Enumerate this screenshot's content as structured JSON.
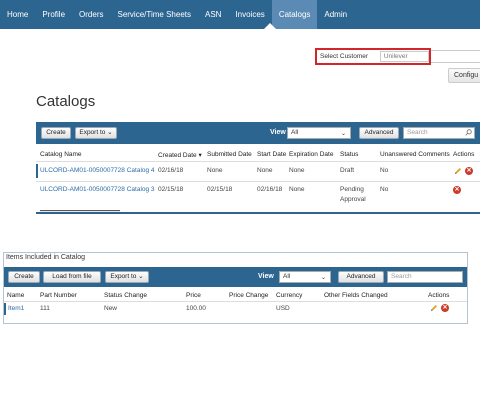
{
  "nav": {
    "items": [
      "Home",
      "Profile",
      "Orders",
      "Service/Time Sheets",
      "ASN",
      "Invoices",
      "Catalogs",
      "Admin"
    ],
    "active": "Catalogs"
  },
  "customer": {
    "label": "Select Customer",
    "value": "Unilever"
  },
  "configure_label": "Configu",
  "page_title": "Catalogs",
  "catalogs_toolbar": {
    "create": "Create",
    "export": "Export to ⌄",
    "view_label": "View",
    "view_value": "All",
    "advanced": "Advanced",
    "search_placeholder": "Search"
  },
  "catalogs_table": {
    "headers": [
      "Catalog Name",
      "Created Date ▾",
      "Submitted Date",
      "Start Date",
      "Expiration Date",
      "Status",
      "Unanswered Comments",
      "Actions"
    ],
    "rows": [
      {
        "name": "ULCORD-AM01-0050007728 Catalog 4",
        "created": "02/16/18",
        "submitted": "None",
        "start": "None",
        "expiration": "None",
        "status": "Draft",
        "status2": "",
        "comments": "No"
      },
      {
        "name": "ULCORD-AM01-0050007728 Catalog 3",
        "created": "02/15/18",
        "submitted": "02/15/18",
        "start": "02/16/18",
        "expiration": "None",
        "status": "Pending",
        "status2": "Approval",
        "comments": "No"
      }
    ]
  },
  "items_panel": {
    "title": "Items Included in Catalog",
    "toolbar": {
      "create": "Create",
      "load": "Load from file",
      "export": "Export to ⌄",
      "view_label": "View",
      "view_value": "All",
      "advanced": "Advanced",
      "search_placeholder": "Search"
    },
    "headers": [
      "Name",
      "Part Number",
      "Status Change",
      "Price",
      "Price Change",
      "Currency",
      "Other Fields Changed",
      "Actions"
    ],
    "rows": [
      {
        "name": "Item1",
        "part_number": "111",
        "status_change": "New",
        "price": "100.00",
        "price_change": "",
        "currency": "USD",
        "other": ""
      }
    ]
  },
  "colors": {
    "nav": "#2d6591",
    "active_tab": "#5b8bb4",
    "link": "#2b6ca8",
    "delete": "#cc3a2a",
    "edit": "#e0a020",
    "highlight_border": "#d0262c"
  },
  "icons": {
    "edit": "pencil-icon",
    "delete": "close-circle-icon",
    "search": "search-icon",
    "dropdown": "chevron-down-icon"
  }
}
